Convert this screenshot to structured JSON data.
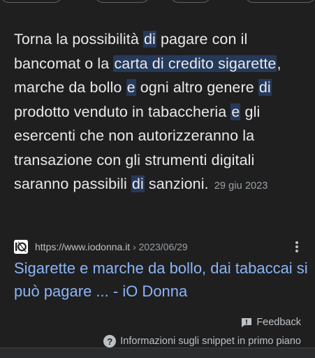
{
  "snippet": {
    "parts": [
      {
        "text": "Torna la possibilità ",
        "hl": false
      },
      {
        "text": "di",
        "hl": true
      },
      {
        "text": " pagare con il bancomat o la ",
        "hl": false
      },
      {
        "text": "carta di credito sigarette",
        "hl": true
      },
      {
        "text": ", marche da bollo ",
        "hl": false
      },
      {
        "text": "e",
        "hl": true
      },
      {
        "text": " ogni altro genere ",
        "hl": false
      },
      {
        "text": "di",
        "hl": true
      },
      {
        "text": " prodotto venduto in tabaccheria ",
        "hl": false
      },
      {
        "text": "e",
        "hl": true
      },
      {
        "text": " gli esercenti che non autorizzeranno la transazione con gli strumenti digitali saranno passibili ",
        "hl": false
      },
      {
        "text": "di",
        "hl": true
      },
      {
        "text": " sanzioni.",
        "hl": false
      }
    ],
    "date": "29 giu 2023",
    "highlight_color": "#25395b"
  },
  "result": {
    "favicon": "iodonna-logo-icon",
    "url": "https://www.iodonna.it",
    "separator": "›",
    "breadcrumb": "2023/06/29",
    "title": "Sigarette e marche da bollo, dai tabaccai si può pagare ... - iO Donna",
    "title_color": "#8ab4f8"
  },
  "menu": {
    "icon": "more-vert-icon"
  },
  "footer": {
    "feedback_label": "Feedback",
    "feedback_icon": "feedback-flag-icon",
    "info_label": "Informazioni sugli snippet in primo piano",
    "info_icon": "help-circle-icon"
  }
}
